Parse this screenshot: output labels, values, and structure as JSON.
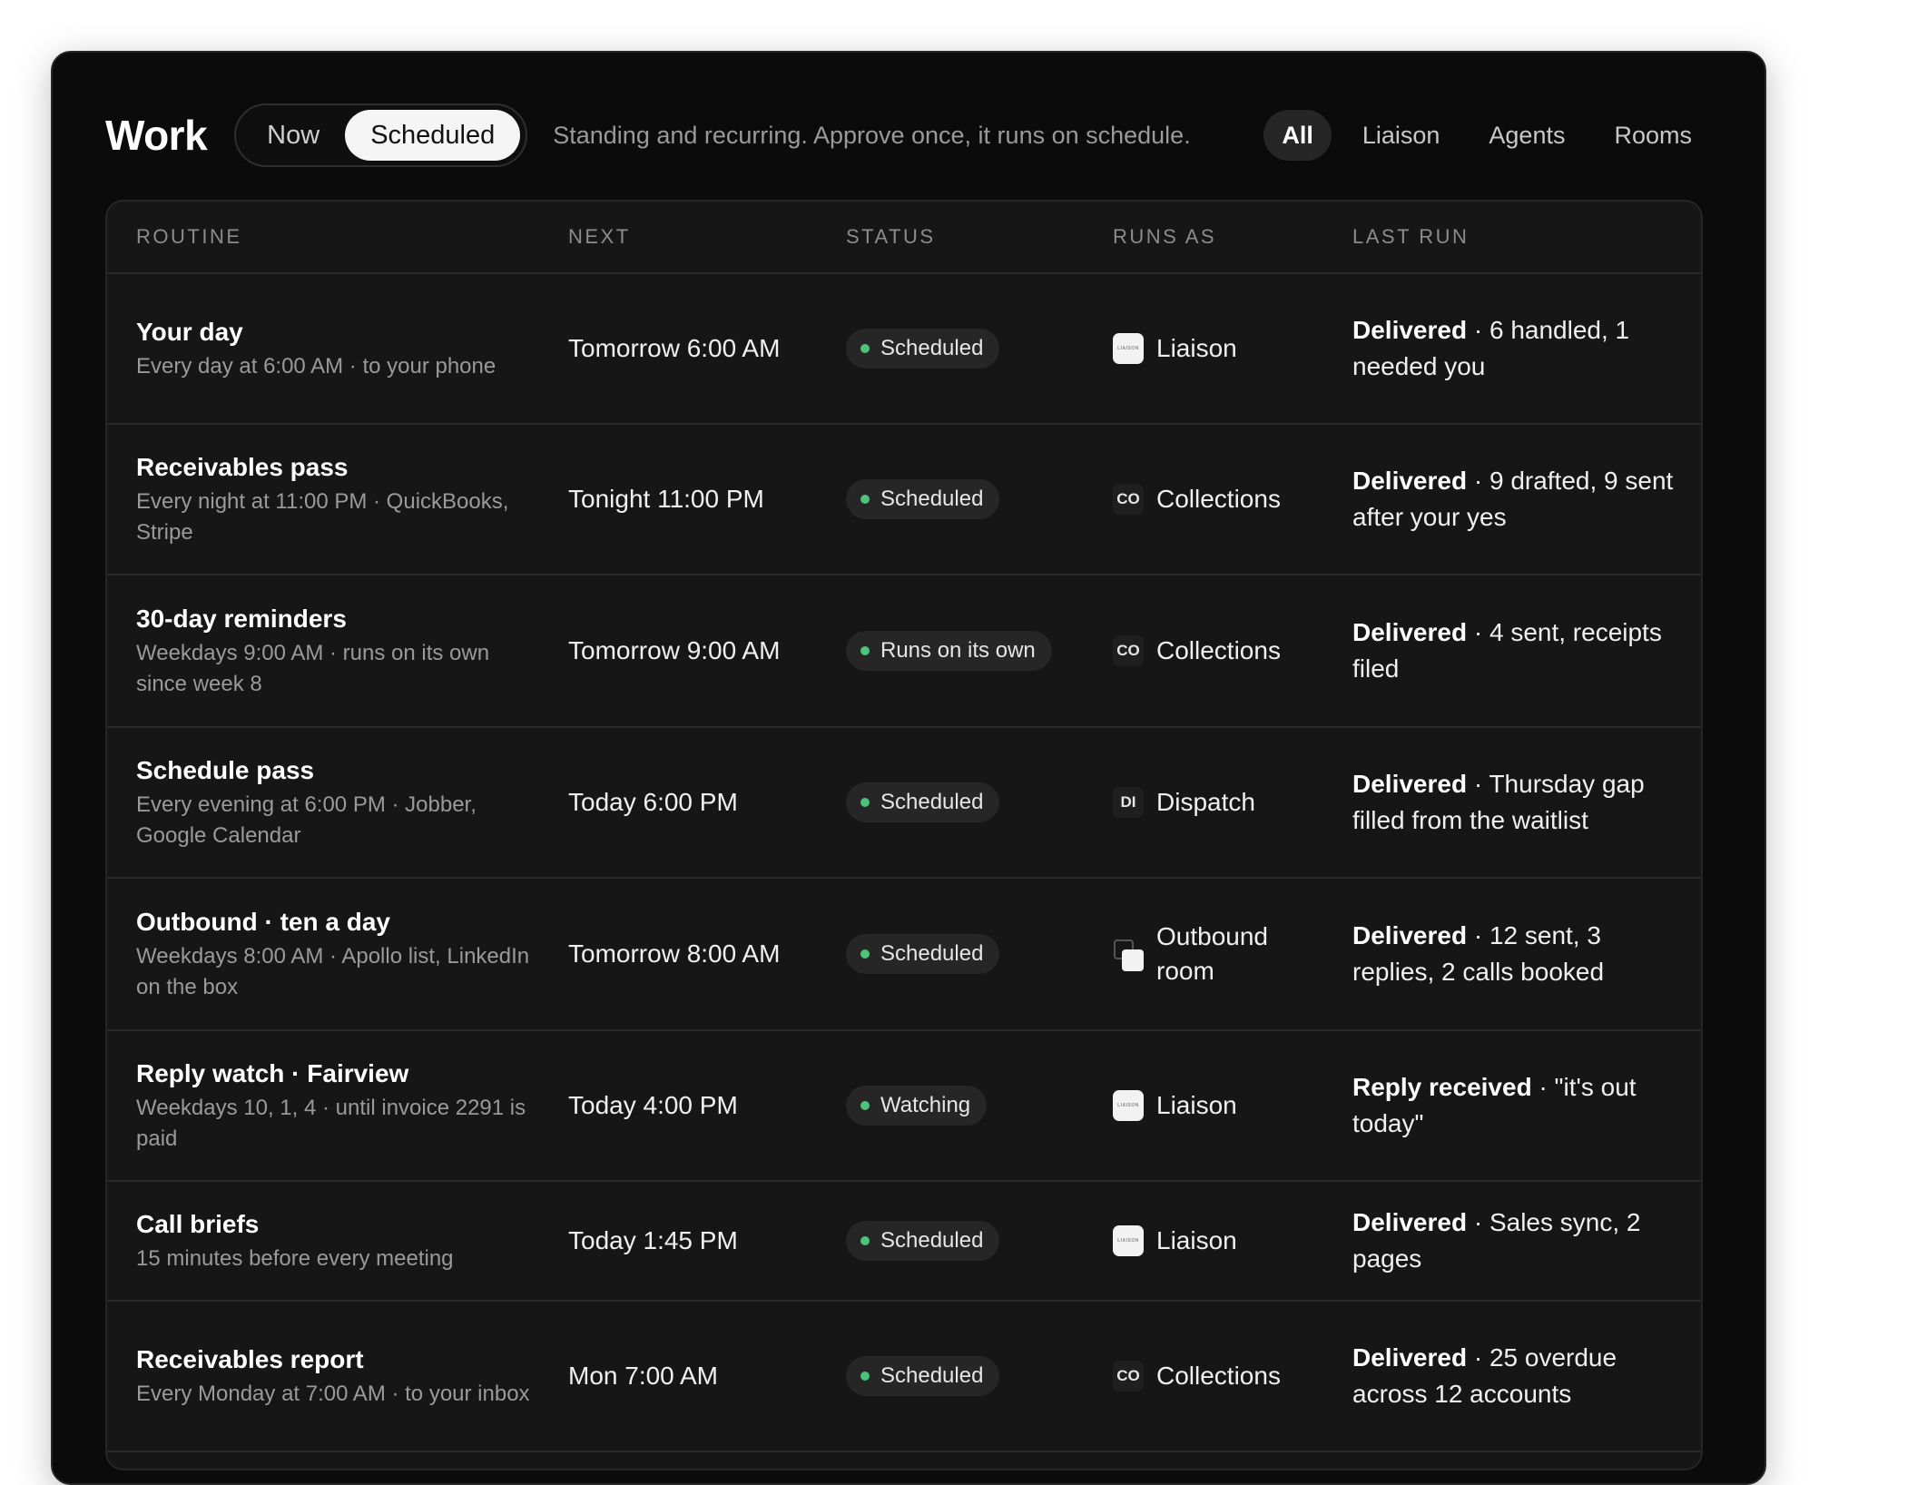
{
  "header": {
    "title": "Work",
    "modes": [
      "Now",
      "Scheduled"
    ],
    "active_mode": "Scheduled",
    "subtitle": "Standing and recurring. Approve once, it runs on schedule.",
    "filters": [
      "All",
      "Liaison",
      "Agents",
      "Rooms"
    ],
    "active_filter": "All"
  },
  "table": {
    "columns": [
      "ROUTINE",
      "NEXT",
      "STATUS",
      "RUNS AS",
      "LAST RUN"
    ],
    "rows": [
      {
        "name": "Your day",
        "desc": "Every day at 6:00 AM · to your phone",
        "next": "Tomorrow 6:00 AM",
        "status": "Scheduled",
        "runs_as": "Liaison",
        "runs_icon": "liaison-logo-icon",
        "last_status": "Delivered",
        "last_detail": " · 6 handled, 1 needed you"
      },
      {
        "name": "Receivables pass",
        "desc": "Every night at 11:00 PM · QuickBooks, Stripe",
        "next": "Tonight 11:00 PM",
        "status": "Scheduled",
        "runs_as": "Collections",
        "runs_icon": "co-agent-icon",
        "icon_text": "CO",
        "last_status": "Delivered",
        "last_detail": " · 9 drafted, 9 sent after your yes"
      },
      {
        "name": "30-day reminders",
        "desc": "Weekdays 9:00 AM · runs on its own since week 8",
        "next": "Tomorrow 9:00 AM",
        "status": "Runs on its own",
        "runs_as": "Collections",
        "runs_icon": "co-agent-icon",
        "icon_text": "CO",
        "last_status": "Delivered",
        "last_detail": " · 4 sent, receipts filed"
      },
      {
        "name": "Schedule pass",
        "desc": "Every evening at 6:00 PM · Jobber, Google Calendar",
        "next": "Today 6:00 PM",
        "status": "Scheduled",
        "runs_as": "Dispatch",
        "runs_icon": "di-agent-icon",
        "icon_text": "DI",
        "last_status": "Delivered",
        "last_detail": " · Thursday gap filled from the waitlist"
      },
      {
        "name": "Outbound · ten a day",
        "desc": "Weekdays 8:00 AM · Apollo list, LinkedIn on the box",
        "next": "Tomorrow 8:00 AM",
        "status": "Scheduled",
        "runs_as": "Outbound room",
        "runs_icon": "room-icon",
        "last_status": "Delivered",
        "last_detail": " · 12 sent, 3 replies, 2 calls booked"
      },
      {
        "name": "Reply watch · Fairview",
        "desc": "Weekdays 10, 1, 4 · until invoice 2291 is paid",
        "next": "Today 4:00 PM",
        "status": "Watching",
        "runs_as": "Liaison",
        "runs_icon": "liaison-logo-icon",
        "last_status": "Reply received",
        "last_detail": " · \"it's out today\""
      },
      {
        "name": "Call briefs",
        "desc": "15 minutes before every meeting",
        "next": "Today 1:45 PM",
        "status": "Scheduled",
        "runs_as": "Liaison",
        "runs_icon": "liaison-logo-icon",
        "last_status": "Delivered",
        "last_detail": " · Sales sync, 2 pages"
      },
      {
        "name": "Receivables report",
        "desc": "Every Monday at 7:00 AM · to your inbox",
        "next": "Mon 7:00 AM",
        "status": "Scheduled",
        "runs_as": "Collections",
        "runs_icon": "co-agent-icon",
        "icon_text": "CO",
        "last_status": "Delivered",
        "last_detail": " · 25 overdue across 12 accounts"
      }
    ]
  },
  "colors": {
    "background": "#0b0b0b",
    "panel": "#161616",
    "status_dot": "#4cc37a"
  }
}
